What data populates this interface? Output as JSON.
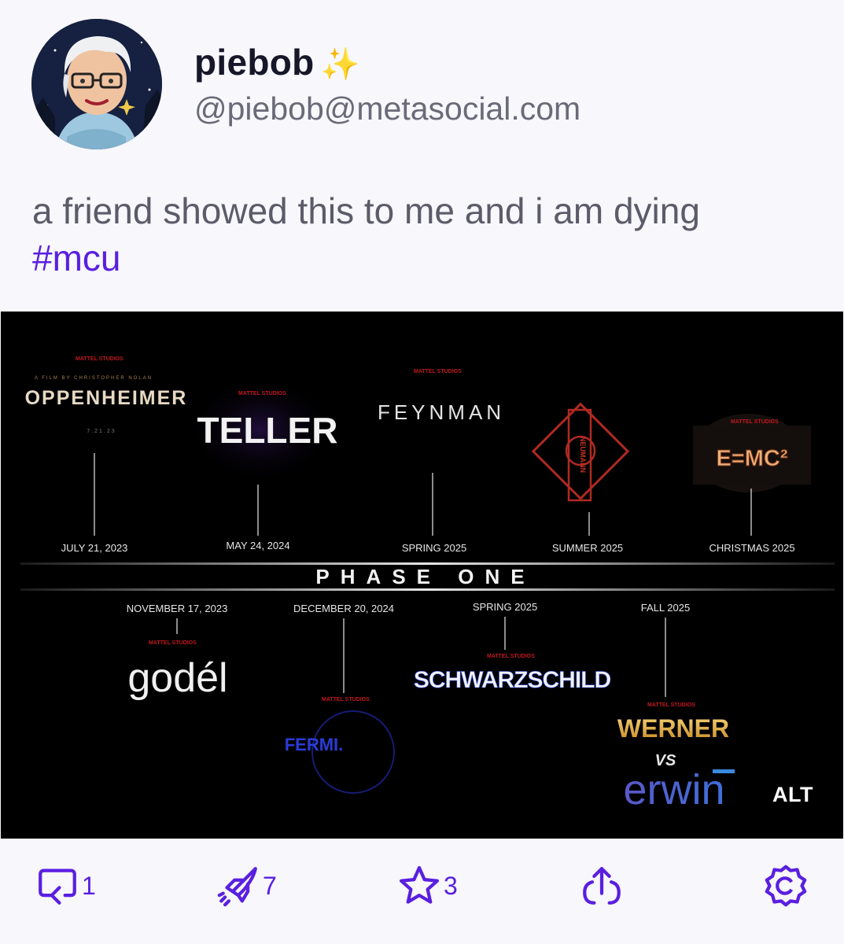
{
  "post": {
    "display_name": "piebob",
    "sparkle": "✨",
    "handle": "@piebob@metasocial.com",
    "text": "a friend showed this to me and i am dying",
    "hashtag": "#mcu"
  },
  "media": {
    "alt_label": "ALT",
    "studio_label": "MATTEL STUDIOS",
    "phase_title": "PHASE ONE",
    "upper_films": [
      {
        "title": "OPPENHEIMER",
        "date": "JULY 21, 2023",
        "subtitle": "A FILM BY CHRISTOPHER NOLAN",
        "small": "7.21.23"
      },
      {
        "title": "TELLER",
        "date": "MAY 24, 2024"
      },
      {
        "title": "FEYNMAN",
        "date": "SPRING 2025"
      },
      {
        "title": "NEUMANN",
        "date": "SUMMER 2025"
      },
      {
        "title": "E=MC²",
        "date": "CHRISTMAS 2025"
      }
    ],
    "lower_films": [
      {
        "title": "godél",
        "date": "NOVEMBER 17, 2023"
      },
      {
        "title": "FERMI.",
        "date": "DECEMBER 20, 2024"
      },
      {
        "title": "SCHWARZSCHILD",
        "date": "SPRING 2025"
      },
      {
        "title": "WERNER",
        "vs": "VS",
        "title2": "erwin",
        "date": "FALL 2025"
      }
    ]
  },
  "actions": {
    "reply_count": "1",
    "boost_count": "7",
    "favourite_count": "3",
    "share_count": "",
    "more_count": ""
  },
  "colors": {
    "accent": "#5a1fe0",
    "background": "#f7f7fc",
    "muted_text": "#6a6a78"
  }
}
